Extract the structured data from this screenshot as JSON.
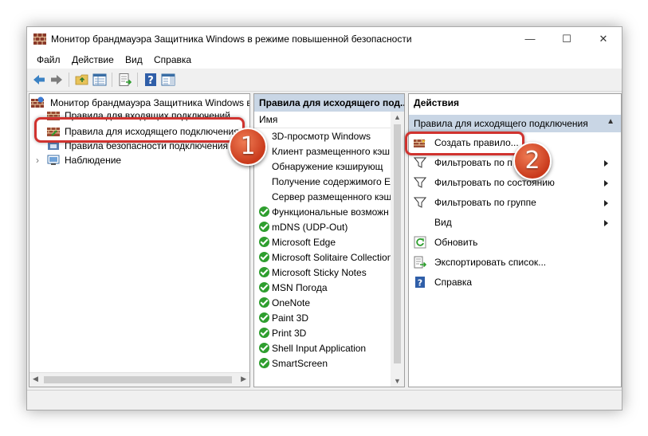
{
  "window": {
    "title": "Монитор брандмауэра Защитника Windows в режиме повышенной безопасности",
    "controls": {
      "minimize": "—",
      "maximize": "☐",
      "close": "✕"
    }
  },
  "menu": [
    "Файл",
    "Действие",
    "Вид",
    "Справка"
  ],
  "tree": {
    "root": "Монитор брандмауэра Защитника Windows в",
    "items": [
      "Правила для входящих подключений",
      "Правила для исходящего подключения",
      "Правила безопасности подключения",
      "Наблюдение"
    ]
  },
  "rules_pane": {
    "header": "Правила для исходящего под...",
    "column": "Имя",
    "rows": [
      {
        "name": "3D-просмотр Windows",
        "enabled": false
      },
      {
        "name": "Клиент размещенного кэш",
        "enabled": false
      },
      {
        "name": "Обнаружение кэширующ",
        "enabled": false
      },
      {
        "name": "Получение содержимого Е",
        "enabled": false
      },
      {
        "name": "Сервер размещенного кэш",
        "enabled": false
      },
      {
        "name": "Функциональные возможн",
        "enabled": true
      },
      {
        "name": "mDNS (UDP-Out)",
        "enabled": true
      },
      {
        "name": "Microsoft Edge",
        "enabled": true
      },
      {
        "name": "Microsoft Solitaire Collection",
        "enabled": true
      },
      {
        "name": "Microsoft Sticky Notes",
        "enabled": true
      },
      {
        "name": "MSN Погода",
        "enabled": true
      },
      {
        "name": "OneNote",
        "enabled": true
      },
      {
        "name": "Paint 3D",
        "enabled": true
      },
      {
        "name": "Print 3D",
        "enabled": true
      },
      {
        "name": "Shell Input Application",
        "enabled": true
      },
      {
        "name": "SmartScreen",
        "enabled": true
      }
    ]
  },
  "actions_pane": {
    "header": "Действия",
    "section": "Правила для исходящего подключения",
    "items": [
      {
        "label": "Создать правило...",
        "icon": "new-rule-icon",
        "submenu": false
      },
      {
        "label": "Фильтровать по п",
        "icon": "filter-icon",
        "submenu": true
      },
      {
        "label": "Фильтровать по состоянию",
        "icon": "filter-icon",
        "submenu": true
      },
      {
        "label": "Фильтровать по группе",
        "icon": "filter-icon",
        "submenu": true
      },
      {
        "label": "Вид",
        "icon": "",
        "submenu": true
      },
      {
        "label": "Обновить",
        "icon": "refresh-icon",
        "submenu": false
      },
      {
        "label": "Экспортировать список...",
        "icon": "export-icon",
        "submenu": false
      },
      {
        "label": "Справка",
        "icon": "help-icon",
        "submenu": false
      }
    ]
  },
  "callouts": {
    "first": "1",
    "second": "2"
  },
  "colors": {
    "callout_red": "#d0332f",
    "pane_header": "#c9d6e5",
    "check_green": "#2e9e2e"
  }
}
